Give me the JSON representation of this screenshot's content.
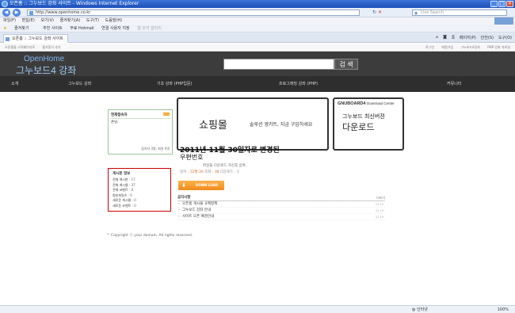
{
  "browser": {
    "title": "오픈홈 :: 그누보드 강좌 사이트 - Windows Internet Explorer",
    "url": "http://www.openhome.co.kr",
    "search_placeholder": "Live Search",
    "menu": [
      "파일(F)",
      "편집(E)",
      "보기(V)",
      "즐겨찾기(A)",
      "도구(T)",
      "도움말(H)"
    ],
    "favorites_label": "즐겨찾기",
    "favorites_links": [
      "추천 사이트",
      "무료 Hotmail",
      "연결 사용자 지정",
      "웹 조각 갤러리"
    ],
    "tab_title": "오픈홈 :: 그누보드 강좌 사이트",
    "tab_tools": [
      "페이지(P)",
      "안전(S)",
      "도구(O)"
    ],
    "status_left": "",
    "status_zone": "인터넷",
    "status_zoom": "100%"
  },
  "site": {
    "top_links_left": [
      "오픈홈을 시작페이지로",
      "즐겨찾기 추가"
    ],
    "top_links_right": [
      "로그인",
      "회원가입",
      "그누보드4강좌",
      "PHP 강좌 자료실"
    ],
    "logo_line1": "OpenHome",
    "logo_line2": "그누보드4 강좌",
    "search_button": "검 색",
    "nav": [
      "소개",
      "그누보드 강좌",
      "기초 강좌 (PHP입문)",
      "프로그래밍 강좌 (PHP)",
      "커뮤니티"
    ],
    "login": {
      "title": "현재접속자",
      "badge": "more",
      "guest": "손님",
      "footer": "접속자 3명, 회원 0명"
    },
    "stats": {
      "title": "게시판 정보",
      "rows": [
        {
          "label": "전체 게시판",
          "value": ": 17"
        },
        {
          "label": "전체 게시물",
          "value": ": 37"
        },
        {
          "label": "전체 코멘트",
          "value": ": 0"
        },
        {
          "label": "첨부파일수",
          "value": ": 6"
        },
        {
          "label": "새로운 게시물",
          "value": ": 0"
        },
        {
          "label": "새로운 코멘트",
          "value": ": 0"
        }
      ]
    },
    "shop_banner": {
      "title": "쇼핑몰",
      "subtitle": "솔루션 영카트, 지금 구입하세요"
    },
    "gnu_banner": {
      "head_bold": "GNUBOARD4",
      "head_light": "Download Center",
      "line2": "그누보드 최신버젼",
      "line3": "다운로드"
    },
    "update": {
      "title": "2011년 11월 30일자로 변경된",
      "subtitle": "우편번호",
      "note": "파일을 다운로드 하신후 압축",
      "meta_prefix": "날자 :",
      "meta_date": "12월 30",
      "meta_mid": "조회 :",
      "meta_count": "38",
      "meta_suffix": "다운로드 : 3"
    },
    "download_button": "DOWN LOAD",
    "notice": {
      "title": "공지사항",
      "more": "더보기",
      "items": [
        {
          "text": "오픈홈 게시물 규제정책",
          "date": "12-19"
        },
        {
          "text": "그누보드 강좌 안내",
          "date": "12-19"
        },
        {
          "text": "사이트 오픈 배경안내",
          "date": "12-19"
        }
      ]
    },
    "copyright": "™ Copyright ⓒ your domain. All rights reserved."
  }
}
